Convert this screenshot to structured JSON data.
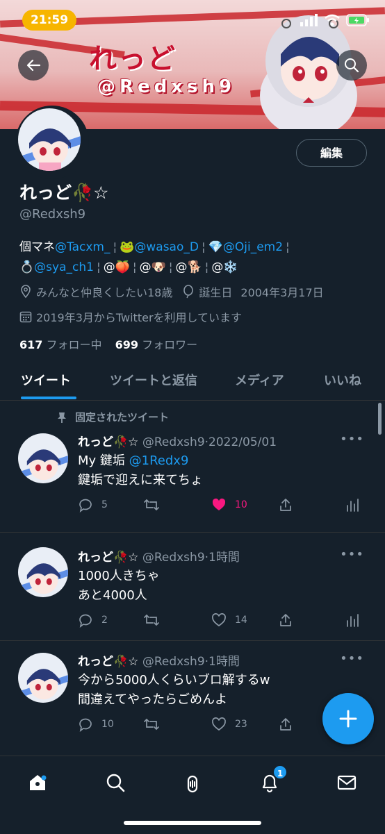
{
  "status": {
    "time": "21:59"
  },
  "banner": {
    "logo_text": "れっど",
    "handle_text": "@Redxsh9"
  },
  "profile": {
    "edit_label": "編集",
    "name": "れっど🥀☆",
    "screen_name": "@Redxsh9",
    "bio_line1": [
      "個マネ",
      "@Tacxm_",
      "🐸",
      "@wasao_D",
      "💎",
      "@Oji_em2"
    ],
    "bio_line2": [
      "💍",
      "@sya_ch1",
      "@🍑",
      "@🐶",
      "@🐕",
      "@❄️"
    ],
    "location": "みんなと仲良くしたい18歳",
    "birthday_label": "誕生日",
    "birthday": "2004年3月17日",
    "joined": "2019年3月からTwitterを利用しています",
    "following_count": "617",
    "following_label": "フォロー中",
    "followers_count": "699",
    "followers_label": "フォロワー"
  },
  "tabs": [
    "ツイート",
    "ツイートと返信",
    "メディア",
    "いいね"
  ],
  "pinned_label": "固定されたツイート",
  "tweets": [
    {
      "name": "れっど🥀☆",
      "handle": "@Redxsh9",
      "time": "2022/05/01",
      "line1_prefix": "My 鍵垢 ",
      "line1_link": "@1Redx9",
      "line2": "鍵垢で迎えに来てちょ",
      "replies": "5",
      "retweets": "",
      "likes": "10"
    },
    {
      "name": "れっど🥀☆",
      "handle": "@Redxsh9",
      "time": "1時間",
      "line1": "1000人きちゃ",
      "line2": "あと4000人",
      "replies": "2",
      "retweets": "",
      "likes": "14"
    },
    {
      "name": "れっど🥀☆",
      "handle": "@Redxsh9",
      "time": "1時間",
      "line1": "今から5000人くらいブロ解するw",
      "line2": "間違えてやったらごめんよ",
      "replies": "10",
      "retweets": "",
      "likes": "23"
    }
  ],
  "nav": {
    "notifications_badge": "1"
  },
  "colors": {
    "background": "#15202b",
    "accent": "#1d9bf0",
    "like": "#f91880",
    "muted": "#8b98a5"
  },
  "icons": [
    "back-arrow-icon",
    "search-icon",
    "pin-icon",
    "location-icon",
    "balloon-icon",
    "calendar-icon",
    "reply-icon",
    "retweet-icon",
    "like-icon",
    "share-icon",
    "analytics-icon",
    "compose-plus-icon",
    "home-icon",
    "explore-icon",
    "spaces-icon",
    "bell-icon",
    "mail-icon"
  ]
}
